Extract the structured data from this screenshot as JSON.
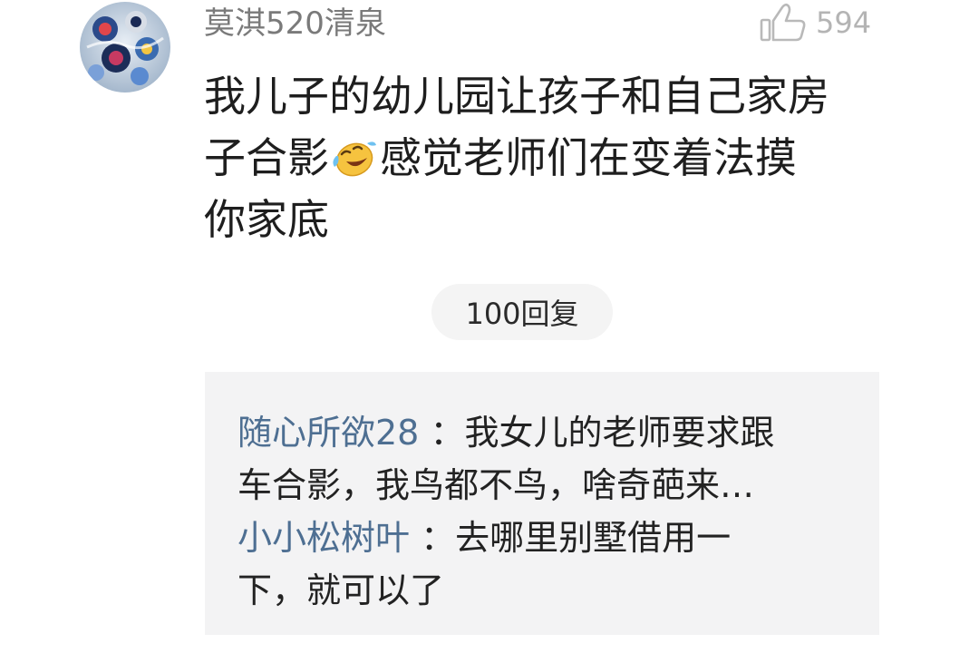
{
  "comment": {
    "username": "莫淇520清泉",
    "like_count": "594",
    "text_lines": [
      "我儿子的幼儿园让孩子和自己家房",
      "子合影",
      "感觉老师们在变着法摸",
      "你家底"
    ],
    "emoji": "laughing-crying-emoji"
  },
  "replies_button": {
    "label": "100回复"
  },
  "replies": [
    {
      "name": "随心所欲28",
      "separator": "：",
      "lines": [
        "我女儿的老师要求跟",
        "车合影，我鸟都不鸟，啥奇葩来…"
      ]
    },
    {
      "name": "小小松树叶",
      "separator": "：",
      "lines": [
        "去哪里别墅借用一",
        "下，就可以了"
      ]
    }
  ],
  "colors": {
    "username": "#7a7a7a",
    "reply_name": "#4e6f92",
    "reply_background": "#f3f3f4",
    "pill_background": "#f4f4f4"
  }
}
